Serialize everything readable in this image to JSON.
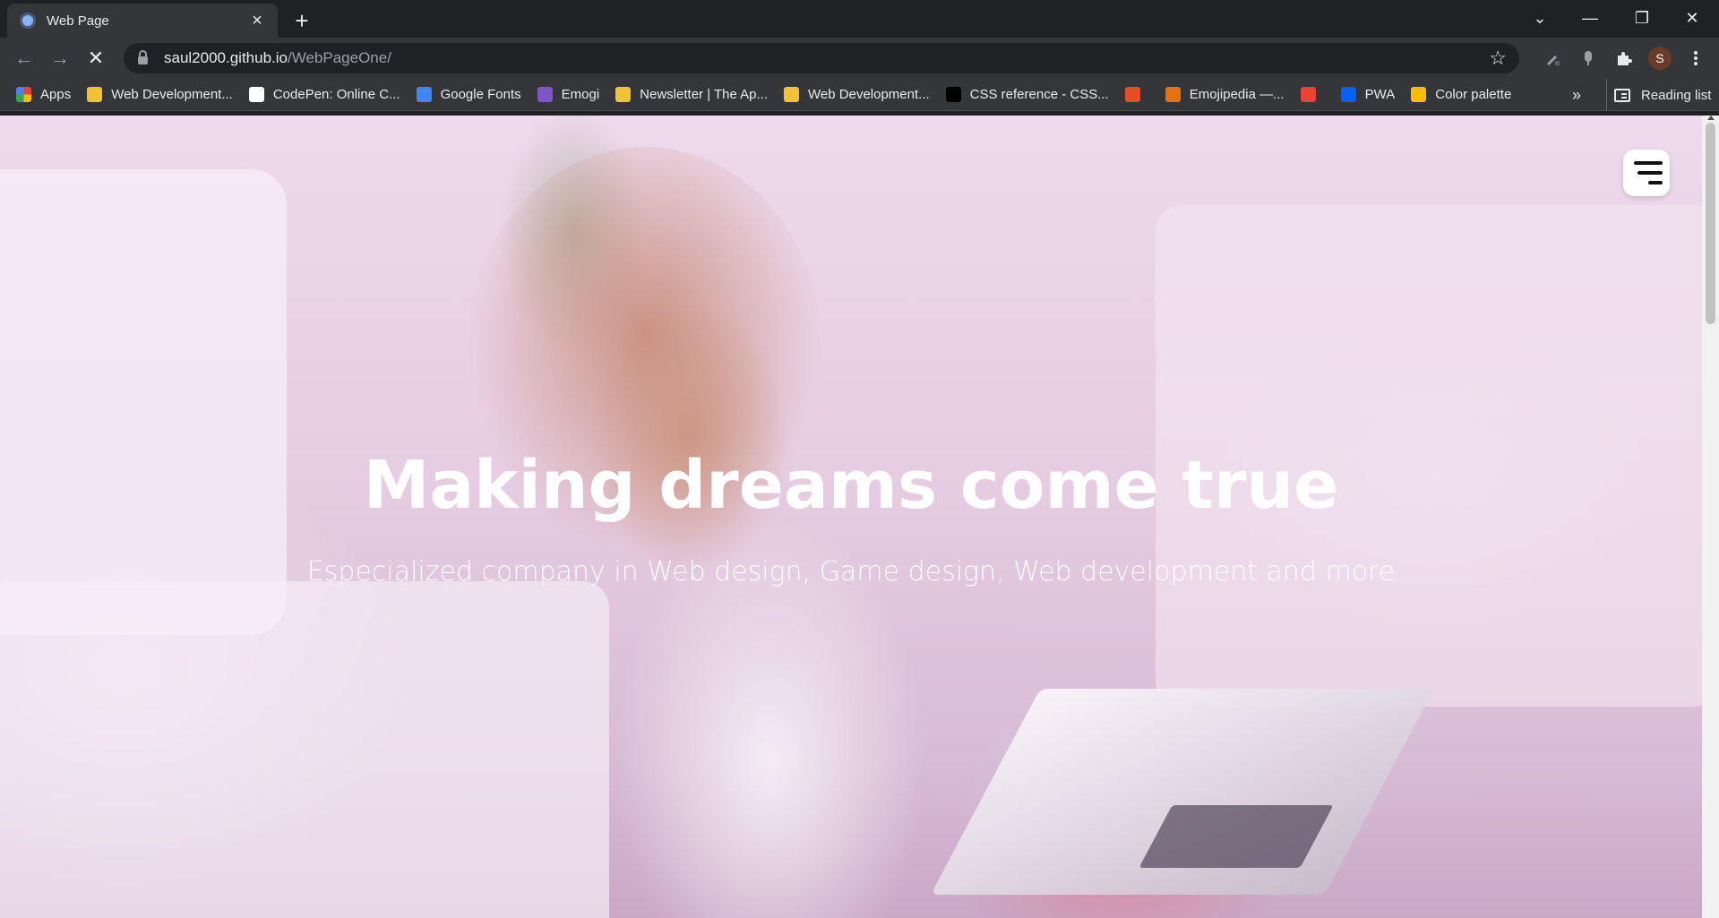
{
  "browser": {
    "tab": {
      "title": "Web Page",
      "close_icon": "×",
      "favicon": "globe-icon"
    },
    "new_tab_icon": "+",
    "window_controls": {
      "tab_search": "⌄",
      "minimize": "—",
      "restore": "❐",
      "close": "✕"
    },
    "nav": {
      "back": "←",
      "forward": "→",
      "stop": "✕"
    },
    "address": {
      "host": "saul2000.github.io",
      "path": "/WebPageOne/"
    },
    "bookmark_star": "☆",
    "profile_initial": "S",
    "bookmarks": [
      {
        "label": "Apps",
        "icon": "apps-grid-icon",
        "color": "#ea4335"
      },
      {
        "label": "Web Development...",
        "icon": "developer-badge-icon",
        "color": "#f1c232"
      },
      {
        "label": "CodePen: Online C...",
        "icon": "codepen-icon",
        "color": "#ffffff"
      },
      {
        "label": "Google Fonts",
        "icon": "google-fonts-icon",
        "color": "#4285f4"
      },
      {
        "label": "Emogi",
        "icon": "emogi-icon",
        "color": "#7e57c2"
      },
      {
        "label": "Newsletter | The Ap...",
        "icon": "developer-badge-icon",
        "color": "#f1c232"
      },
      {
        "label": "Web Development...",
        "icon": "developer-badge-icon",
        "color": "#f1c232"
      },
      {
        "label": "CSS reference - CSS...",
        "icon": "mdn-icon",
        "color": "#000000"
      },
      {
        "label": "",
        "icon": "html5-icon",
        "color": "#e44d26"
      },
      {
        "label": "Emojipedia —...",
        "icon": "emojipedia-icon",
        "color": "#e8710a"
      },
      {
        "label": "",
        "icon": "gmail-icon",
        "color": "#ea4335"
      },
      {
        "label": "PWA",
        "icon": "dropbox-icon",
        "color": "#0061ff"
      },
      {
        "label": "Color palette",
        "icon": "color-palette-icon",
        "color": "#fbbc04"
      }
    ],
    "bookmarks_overflow": "»",
    "reading_list": "Reading list"
  },
  "page": {
    "hero_title": "Making dreams come true",
    "hero_subtitle": "Especialized company in Web design, Game design, Web development and more",
    "menu_icon": "hamburger-menu-icon"
  }
}
